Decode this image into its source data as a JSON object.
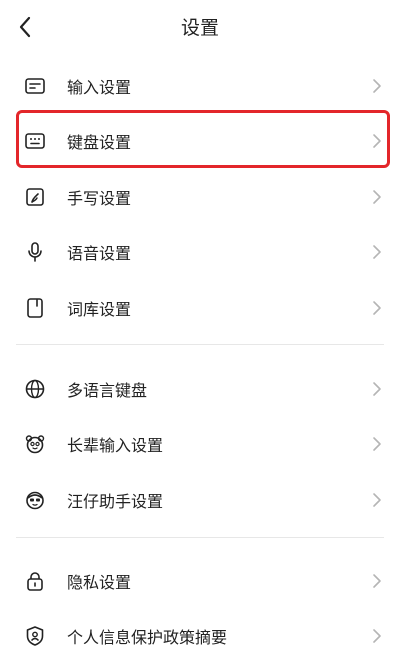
{
  "header": {
    "title": "设置"
  },
  "groups": [
    {
      "items": [
        {
          "label": "输入设置",
          "icon": "input-settings-icon"
        },
        {
          "label": "键盘设置",
          "icon": "keyboard-icon"
        },
        {
          "label": "手写设置",
          "icon": "handwriting-icon"
        },
        {
          "label": "语音设置",
          "icon": "microphone-icon"
        },
        {
          "label": "词库设置",
          "icon": "lexicon-icon"
        }
      ]
    },
    {
      "items": [
        {
          "label": "多语言键盘",
          "icon": "globe-icon"
        },
        {
          "label": "长辈输入设置",
          "icon": "elder-face-icon"
        },
        {
          "label": "汪仔助手设置",
          "icon": "assistant-face-icon"
        }
      ]
    },
    {
      "items": [
        {
          "label": "隐私设置",
          "icon": "lock-icon"
        },
        {
          "label": "个人信息保护政策摘要",
          "icon": "shield-user-icon"
        }
      ]
    }
  ],
  "highlight_color": "#e3262a"
}
